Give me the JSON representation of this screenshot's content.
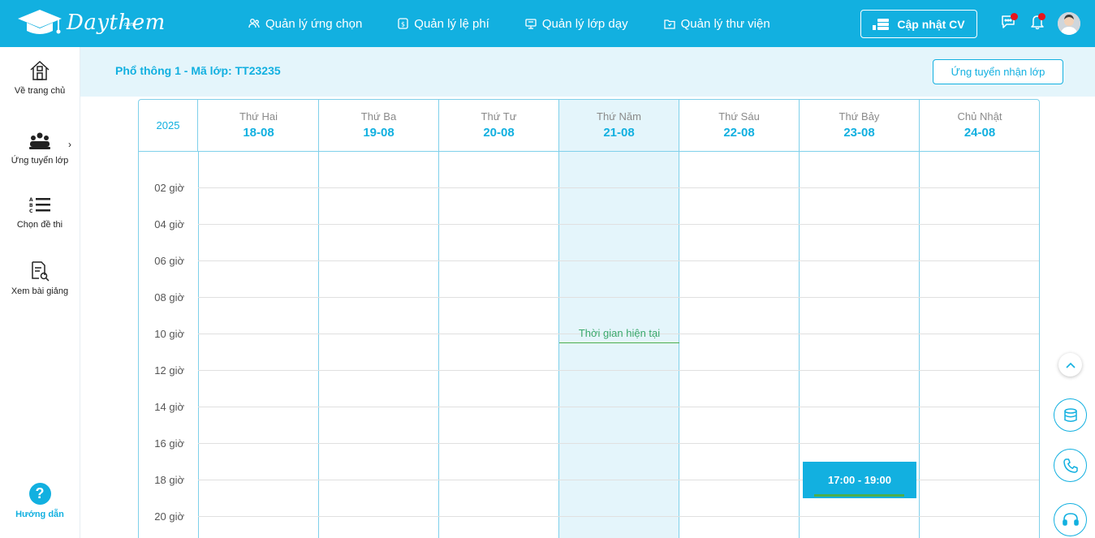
{
  "header": {
    "logo_text": "Daythem",
    "logo_sub": ".com",
    "nav": [
      {
        "label": "Quản lý ứng chọn",
        "icon": "users-icon"
      },
      {
        "label": "Quản lý lệ phí",
        "icon": "fee-icon"
      },
      {
        "label": "Quản lý lớp dạy",
        "icon": "class-icon"
      },
      {
        "label": "Quản lý thư viện",
        "icon": "library-icon"
      }
    ],
    "cv_button": "Cập nhật CV",
    "accent_color": "#12b0e0"
  },
  "sidebar": {
    "items": [
      {
        "label": "Về trang chủ",
        "icon": "home-icon"
      },
      {
        "label": "Ứng tuyển lớp",
        "icon": "group-icon"
      },
      {
        "label": "Chọn đề thi",
        "icon": "list-icon"
      },
      {
        "label": "Xem bài giảng",
        "icon": "document-search-icon"
      }
    ],
    "help_label": "Hướng dẫn"
  },
  "main": {
    "class_title": "Phổ thông 1 - Mã lớp: TT23235",
    "apply_button": "Ứng tuyển nhận lớp"
  },
  "calendar": {
    "year": "2025",
    "days": [
      {
        "name": "Thứ Hai",
        "date": "18-08"
      },
      {
        "name": "Thứ Ba",
        "date": "19-08"
      },
      {
        "name": "Thứ Tư",
        "date": "20-08"
      },
      {
        "name": "Thứ Năm",
        "date": "21-08"
      },
      {
        "name": "Thứ Sáu",
        "date": "22-08"
      },
      {
        "name": "Thứ Bảy",
        "date": "23-08"
      },
      {
        "name": "Chủ Nhật",
        "date": "24-08"
      }
    ],
    "today_index": 3,
    "hours": [
      "02 giờ",
      "04 giờ",
      "06 giờ",
      "08 giờ",
      "10 giờ",
      "12 giờ",
      "14 giờ",
      "16 giờ",
      "18 giờ",
      "20 giờ"
    ],
    "now_label": "Thời gian hiện tại",
    "event": {
      "label": "17:00 - 19:00",
      "day": "Thứ Bảy"
    }
  }
}
